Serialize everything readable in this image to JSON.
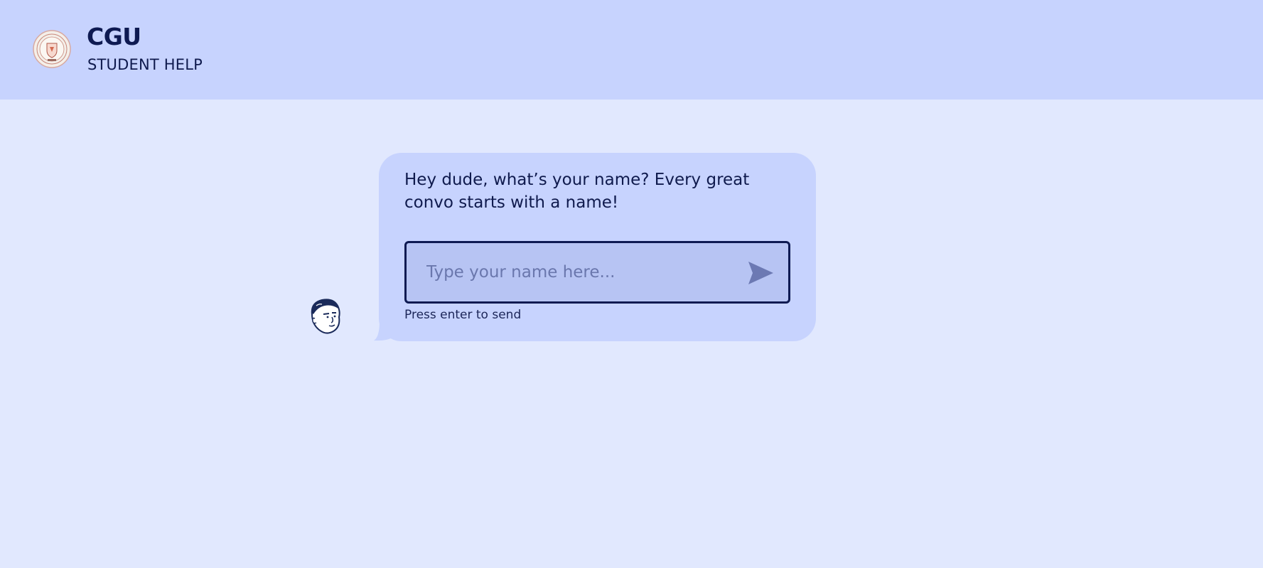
{
  "header": {
    "title": "CGU",
    "subtitle": "STUDENT HELP",
    "logo_icon": "university-seal-icon"
  },
  "chat": {
    "bot_avatar_icon": "cartoon-face-avatar-icon",
    "prompt": "Hey dude, what’s your name? Every great convo starts with a name!",
    "input": {
      "value": "",
      "placeholder": "Type your name here..."
    },
    "send_icon": "send-arrow-icon",
    "hint": "Press enter to send"
  },
  "colors": {
    "background": "#e1e8fe",
    "header": "#c7d3fe",
    "bubble": "#c7d3fe",
    "input_fill": "#b7c4f3",
    "text": "#0f1a4d",
    "send_icon": "#6c79b3"
  }
}
